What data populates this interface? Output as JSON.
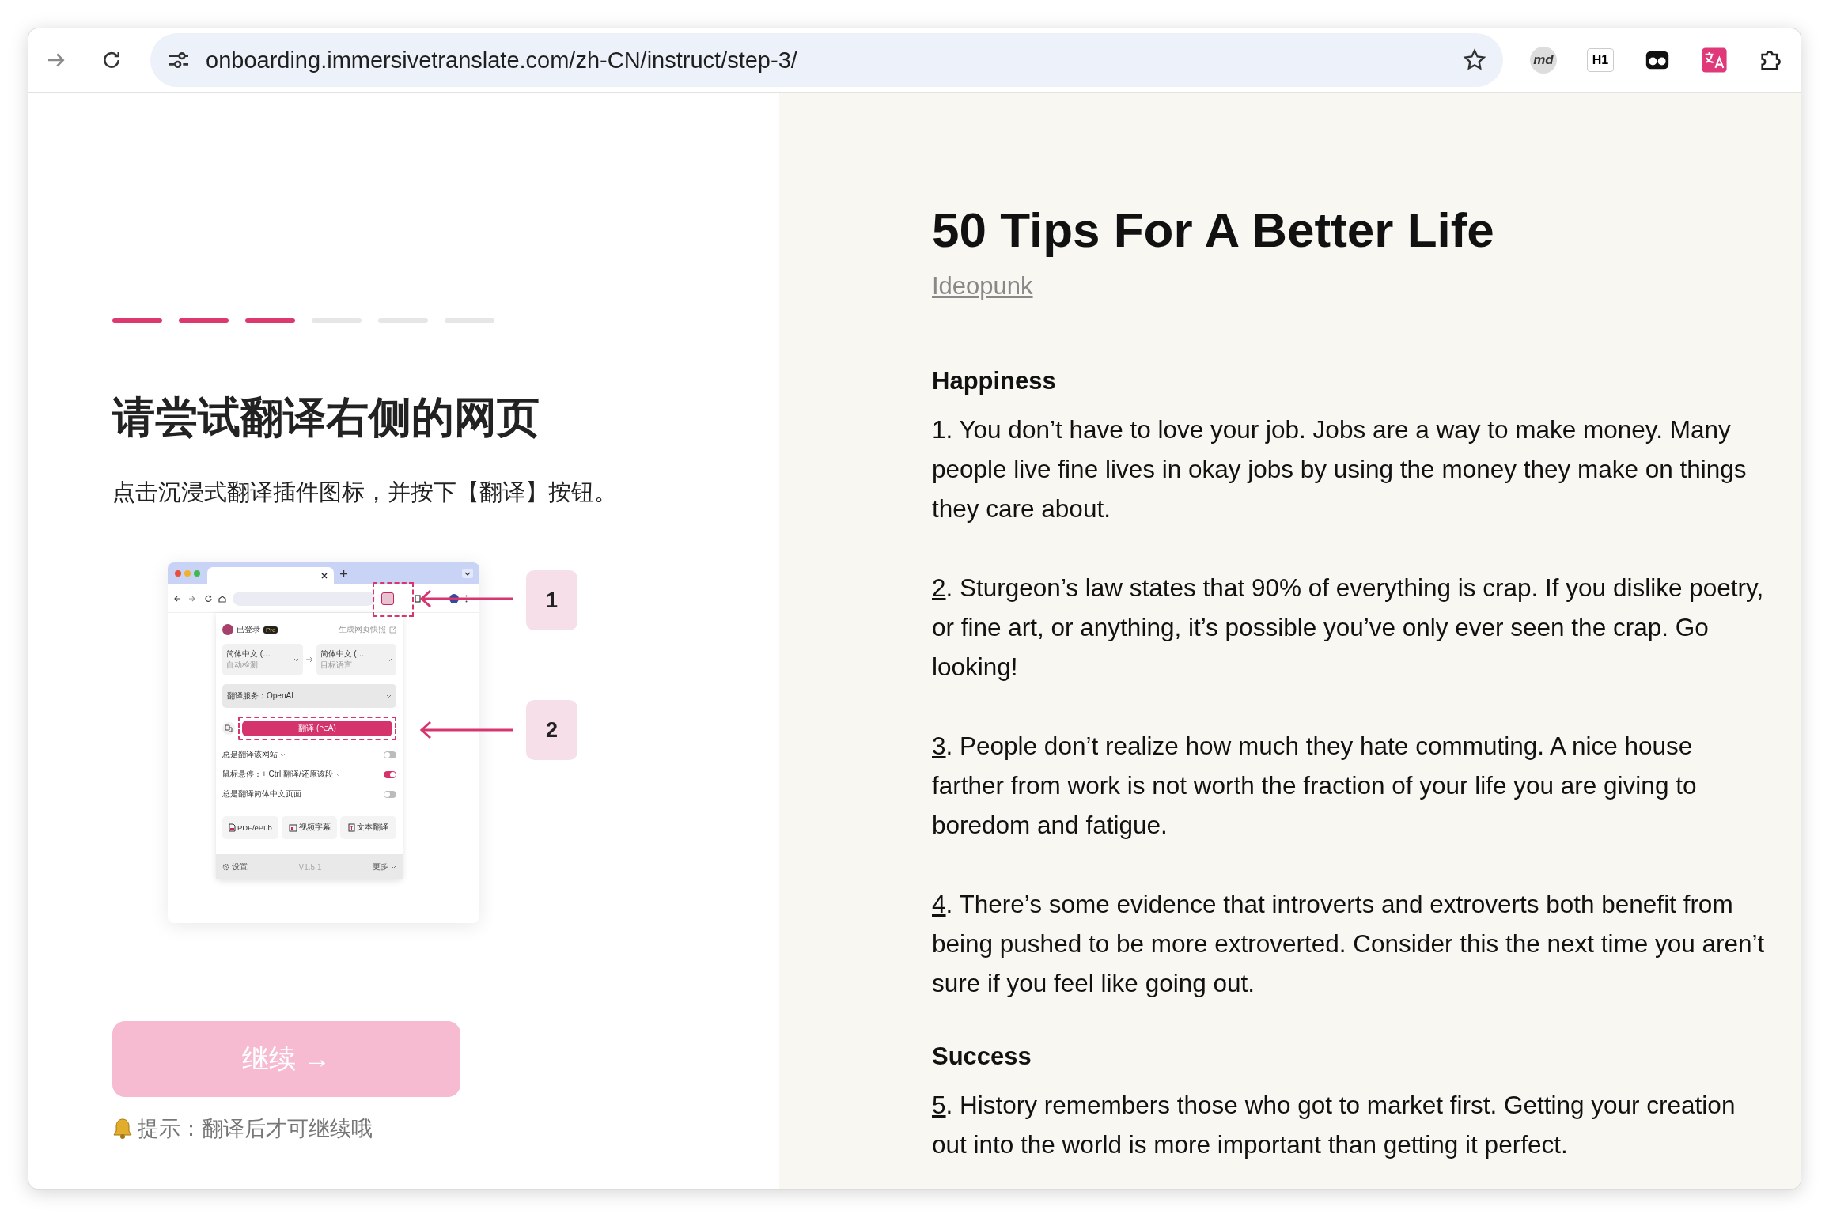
{
  "browser": {
    "url": "onboarding.immersivetranslate.com/zh-CN/instruct/step-3/",
    "extensions": [
      {
        "kind": "badge",
        "label": "md"
      },
      {
        "kind": "tag",
        "label": "H1"
      },
      {
        "kind": "mask"
      },
      {
        "kind": "translate"
      },
      {
        "kind": "puzzle"
      }
    ]
  },
  "onboarding": {
    "steps": [
      {
        "done": true
      },
      {
        "done": true
      },
      {
        "done": true
      },
      {
        "done": false
      },
      {
        "done": false
      },
      {
        "done": false
      }
    ],
    "heading": "请尝试翻译右侧的网页",
    "instruction": "点击沉浸式翻译插件图标，并按下【翻译】按钮。",
    "illustration": {
      "callouts": [
        "1",
        "2"
      ],
      "popup": {
        "user": "已登录",
        "badge": "Pro",
        "snapshot": "生成网页快照",
        "languages": [
          {
            "name": "简体中文 (…",
            "note": "自动检测"
          },
          {
            "name": "简体中文 (…",
            "note": "目标语言"
          }
        ],
        "service": "翻译服务：OpenAI",
        "translate_button": "翻译 (⌥A)",
        "toggles": [
          {
            "label": "总是翻译该网站",
            "has_menu": true,
            "on": false
          },
          {
            "label": "鼠标悬停：+ Ctrl 翻译/还原该段",
            "has_menu": true,
            "on": true
          },
          {
            "label": "总是翻译简体中文页面",
            "has_menu": false,
            "on": false
          }
        ],
        "tools": [
          {
            "kind": "pdf",
            "label": "PDF/ePub"
          },
          {
            "kind": "video",
            "label": "视频字幕"
          },
          {
            "kind": "text",
            "label": "文本翻译"
          }
        ],
        "footer": {
          "settings": "设置",
          "version": "V1.5.1",
          "more": "更多"
        }
      }
    },
    "continue_button": {
      "label": "继续 →",
      "disabled": true
    },
    "hint": "提示：翻译后才可继续哦"
  },
  "article": {
    "title": "50 Tips For A Better Life",
    "author": "Ideopunk",
    "sections": [
      {
        "heading": "Happiness",
        "tips": [
          {
            "number": "1",
            "linked": false,
            "text": ". You don’t have to love your job. Jobs are a way to make money. Many people live fine lives in okay jobs by using the money they make on things they care about."
          },
          {
            "number": "2",
            "linked": true,
            "text": ". Sturgeon’s law states that 90% of everything is crap. If you dislike poetry, or fine art, or anything, it’s possible you’ve only ever seen the crap. Go looking!"
          },
          {
            "number": "3",
            "linked": true,
            "text": ". People don’t realize how much they hate commuting. A nice house farther from work is not worth the fraction of your life you are giving to boredom and fatigue."
          },
          {
            "number": "4",
            "linked": true,
            "text": ". There’s some evidence that introverts and extroverts both benefit from being pushed to be more extroverted. Consider this the next time you aren’t sure if you feel like going out."
          }
        ]
      },
      {
        "heading": "Success",
        "tips": [
          {
            "number": "5",
            "linked": true,
            "text": ". History remembers those who got to market first. Getting your creation out into the world is more important than getting it perfect."
          }
        ]
      }
    ]
  }
}
